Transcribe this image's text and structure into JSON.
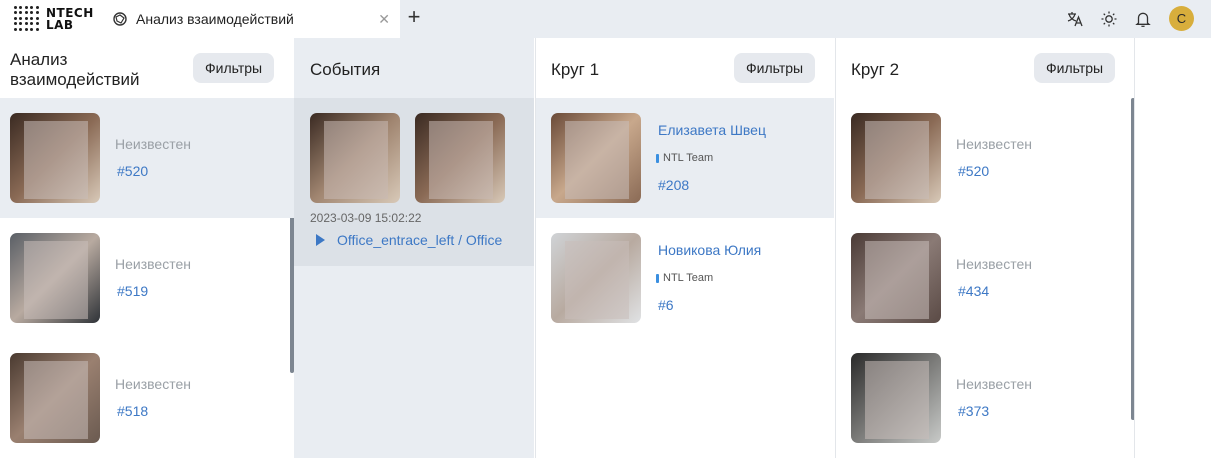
{
  "app": {
    "logo_text_1": "NTECH",
    "logo_text_2": "LAB",
    "tab_title": "Анализ взаимодействий",
    "close_glyph": "✕",
    "new_tab_glyph": "+",
    "user_initial": "С"
  },
  "col1": {
    "title": "Анализ взаимодействий",
    "filter_label": "Фильтры",
    "items": [
      {
        "name": "Неизвестен",
        "id": "#520"
      },
      {
        "name": "Неизвестен",
        "id": "#519"
      },
      {
        "name": "Неизвестен",
        "id": "#518"
      }
    ]
  },
  "col2": {
    "title": "События",
    "event": {
      "datetime": "2023-03-09 15:02:22",
      "camera": "Office_entrace_left / Office"
    }
  },
  "col3": {
    "title": "Круг 1",
    "filter_label": "Фильтры",
    "items": [
      {
        "name": "Елизавета Швец",
        "team": "NTL Team",
        "id": "#208"
      },
      {
        "name": "Новикова Юлия",
        "team": "NTL Team",
        "id": "#6"
      }
    ]
  },
  "col4": {
    "title": "Круг 2",
    "filter_label": "Фильтры",
    "items": [
      {
        "name": "Неизвестен",
        "id": "#520"
      },
      {
        "name": "Неизвестен",
        "id": "#434"
      },
      {
        "name": "Неизвестен",
        "id": "#373"
      }
    ]
  },
  "colors": {
    "accent_link": "#3d78c5",
    "avatar": "#d8ae3c",
    "selected_row": "#e9edf2",
    "team_marker": "#3a8fe0"
  }
}
